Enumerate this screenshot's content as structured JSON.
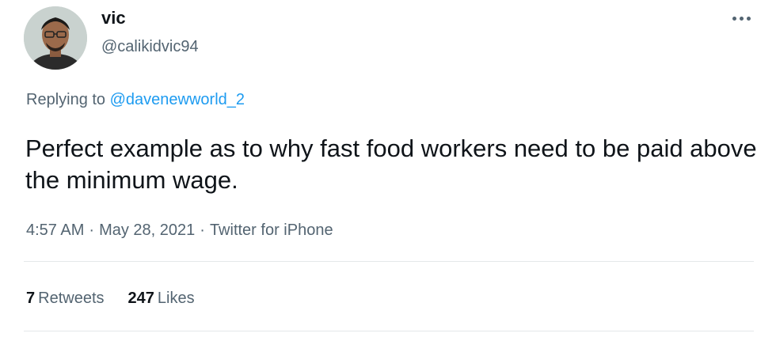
{
  "author": {
    "display_name": "vic",
    "handle": "@calikidvic94"
  },
  "icons": {
    "more": "more-horizontal-icon",
    "avatar": "profile-photo"
  },
  "reply": {
    "prefix": "Replying to ",
    "mention": "@davenewworld_2"
  },
  "tweet": {
    "text": "Perfect example as to why fast food workers need to be paid above the minimum wage."
  },
  "meta": {
    "time": "4:57 AM",
    "date": "May 28, 2021",
    "source": "Twitter for iPhone",
    "separator": "·"
  },
  "stats": {
    "retweets_count": "7",
    "retweets_label": "Retweets",
    "likes_count": "247",
    "likes_label": "Likes"
  },
  "colors": {
    "link": "#1d9bf0",
    "secondary_text": "#536471",
    "primary_text": "#0f1419"
  }
}
